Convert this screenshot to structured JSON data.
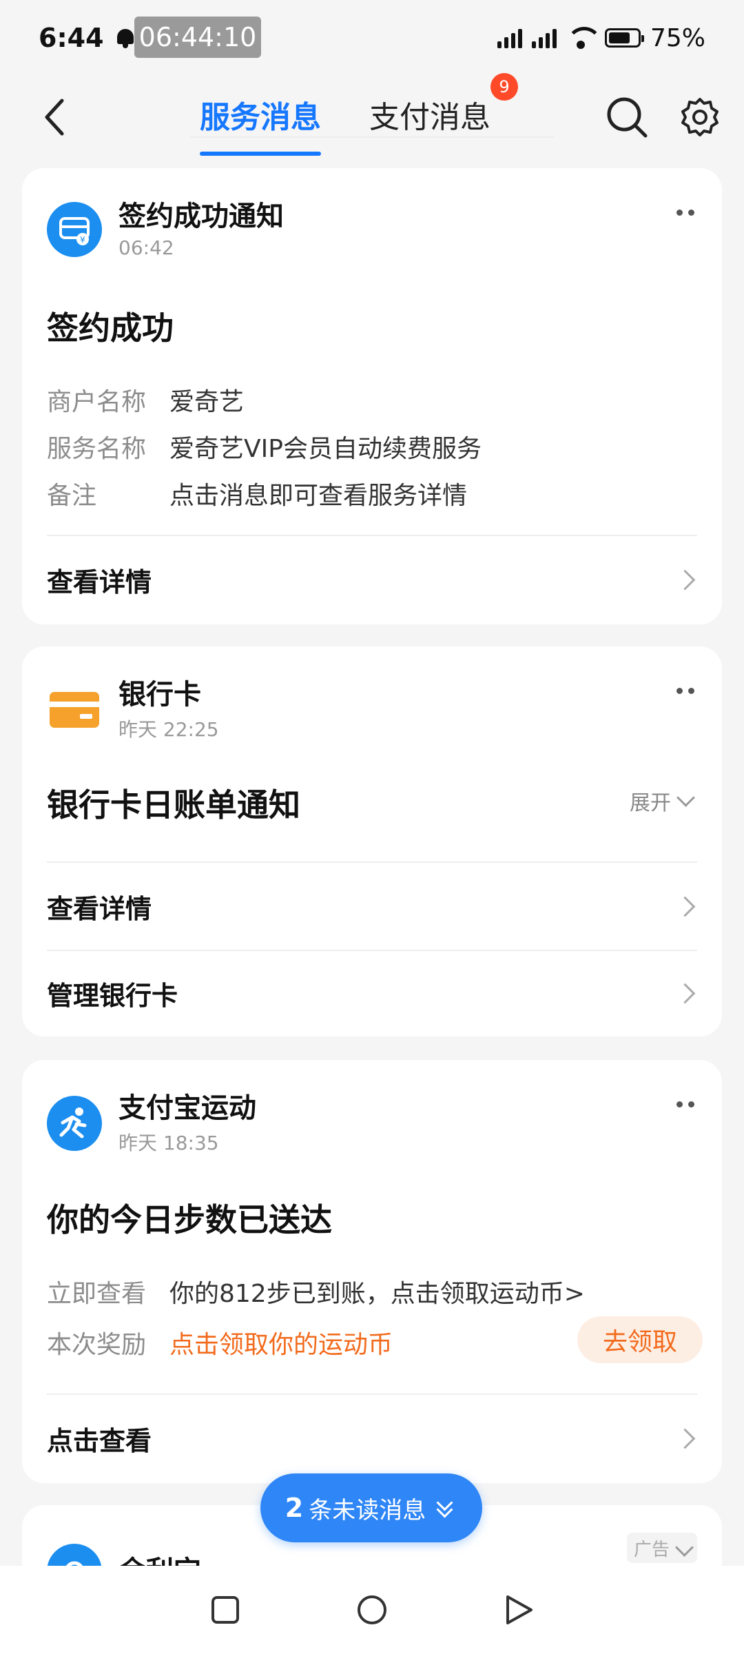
{
  "status_bar": {
    "time": "6:44",
    "recording_time": "06:44:10",
    "battery": "75%"
  },
  "header": {
    "tabs": [
      {
        "label": "服务消息",
        "active": true
      },
      {
        "label": "支付消息",
        "badge": "9"
      }
    ],
    "icons": [
      "back-icon",
      "search-icon",
      "gear-icon"
    ]
  },
  "cards": [
    {
      "source": "签约成功通知",
      "time": "06:42",
      "heading": "签约成功",
      "fields": [
        {
          "key": "商户名称",
          "value": "爱奇艺"
        },
        {
          "key": "服务名称",
          "value": "爱奇艺VIP会员自动续费服务"
        },
        {
          "key": "备注",
          "value": "点击消息即可查看服务详情"
        }
      ],
      "link": "查看详情",
      "icon": "contract-icon",
      "color": "#1b8ef0"
    },
    {
      "source": "银行卡",
      "time": "昨天 22:25",
      "heading": "银行卡日账单通知",
      "expand_label": "展开",
      "links": [
        "查看详情",
        "管理银行卡"
      ],
      "icon": "bank-card-icon",
      "color": "#f5a12b"
    },
    {
      "source": "支付宝运动",
      "time": "昨天 18:35",
      "heading": "你的今日步数已送达",
      "fields": [
        {
          "key": "立即查看",
          "value": "你的812步已到账，点击领取运动币>"
        },
        {
          "key": "本次奖励",
          "value": "点击领取你的运动币"
        }
      ],
      "button": "去领取",
      "link": "点击查看",
      "icon": "running-icon",
      "color": "#1b8ef0"
    },
    {
      "source": "余利宝",
      "ad_label": "广告",
      "icon": "yulibao-icon"
    }
  ],
  "unread": {
    "count": "2",
    "label": "条未读消息"
  },
  "accent_color": "#1677ff",
  "nav": [
    "recent-apps-icon",
    "home-icon",
    "back-nav-icon"
  ]
}
